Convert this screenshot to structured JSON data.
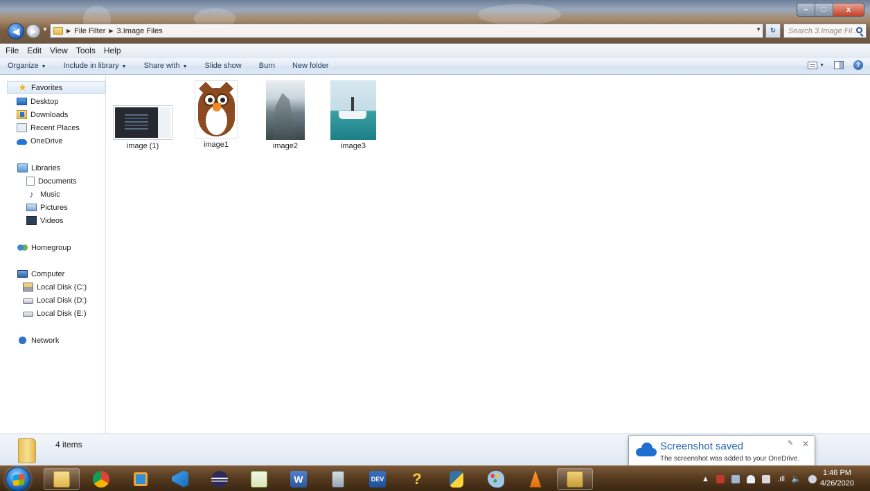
{
  "window": {
    "controls": {
      "minimize": "–",
      "maximize": "□",
      "close": "x"
    }
  },
  "address": {
    "breadcrumb": [
      "File Filter",
      "3.Image Files"
    ],
    "search_placeholder": "Search 3.Image Fil..."
  },
  "menu": [
    "File",
    "Edit",
    "View",
    "Tools",
    "Help"
  ],
  "toolbar": {
    "items": [
      {
        "label": "Organize",
        "dropdown": true
      },
      {
        "label": "Include in library",
        "dropdown": true
      },
      {
        "label": "Share with",
        "dropdown": true
      },
      {
        "label": "Slide show",
        "dropdown": false
      },
      {
        "label": "Burn",
        "dropdown": false
      },
      {
        "label": "New folder",
        "dropdown": false
      }
    ]
  },
  "nav": {
    "favorites": {
      "label": "Favorites",
      "icon": "star-icon",
      "items": [
        {
          "label": "Desktop",
          "icon": "desktop-icon"
        },
        {
          "label": "Downloads",
          "icon": "downloads-icon"
        },
        {
          "label": "Recent Places",
          "icon": "recent-places-icon"
        },
        {
          "label": "OneDrive",
          "icon": "onedrive-icon"
        }
      ]
    },
    "libraries": {
      "label": "Libraries",
      "icon": "libraries-icon",
      "items": [
        {
          "label": "Documents",
          "icon": "documents-icon"
        },
        {
          "label": "Music",
          "icon": "music-icon"
        },
        {
          "label": "Pictures",
          "icon": "pictures-icon"
        },
        {
          "label": "Videos",
          "icon": "videos-icon"
        }
      ]
    },
    "homegroup": {
      "label": "Homegroup",
      "icon": "homegroup-icon"
    },
    "computer": {
      "label": "Computer",
      "icon": "computer-icon",
      "items": [
        {
          "label": "Local Disk (C:)",
          "icon": "system-disk-icon"
        },
        {
          "label": "Local Disk (D:)",
          "icon": "disk-icon"
        },
        {
          "label": "Local Disk (E:)",
          "icon": "disk-icon"
        }
      ]
    },
    "network": {
      "label": "Network",
      "icon": "network-icon"
    }
  },
  "files": [
    {
      "name": "image (1)",
      "icon": "screenshot-thumbnail"
    },
    {
      "name": "image1",
      "icon": "owl-thumbnail"
    },
    {
      "name": "image2",
      "icon": "cliff-photo-thumbnail"
    },
    {
      "name": "image3",
      "icon": "boat-photo-thumbnail"
    }
  ],
  "details": {
    "count": "4 items"
  },
  "notification": {
    "title": "Screenshot saved",
    "message": "The screenshot was added to your OneDrive.",
    "pin": "✎",
    "close": "✕"
  },
  "taskbar": {
    "apps": [
      {
        "name": "file-explorer",
        "color": "#e9c25a"
      },
      {
        "name": "chrome",
        "color": "#dd4b39"
      },
      {
        "name": "screen-recorder",
        "color": "#2e8fd8"
      },
      {
        "name": "vscode",
        "color": "#2a8ad8"
      },
      {
        "name": "eclipse",
        "color": "#3a3565"
      },
      {
        "name": "notepad-plus-plus",
        "color": "#8bc34a"
      },
      {
        "name": "word",
        "color": "#2b579a"
      },
      {
        "name": "calculator",
        "color": "#9aa5b3"
      },
      {
        "name": "dev-cpp",
        "color": "#1f4f9a"
      },
      {
        "name": "help",
        "color": "#e5c23a"
      },
      {
        "name": "python",
        "color": "#3572a5"
      },
      {
        "name": "paint",
        "color": "#6aa8d8"
      },
      {
        "name": "vlc",
        "color": "#f08a1f"
      },
      {
        "name": "terminal",
        "color": "#c69a3a"
      }
    ],
    "dev_label": "DEV",
    "clock": {
      "time": "1:46 PM",
      "date": "4/26/2020"
    }
  }
}
